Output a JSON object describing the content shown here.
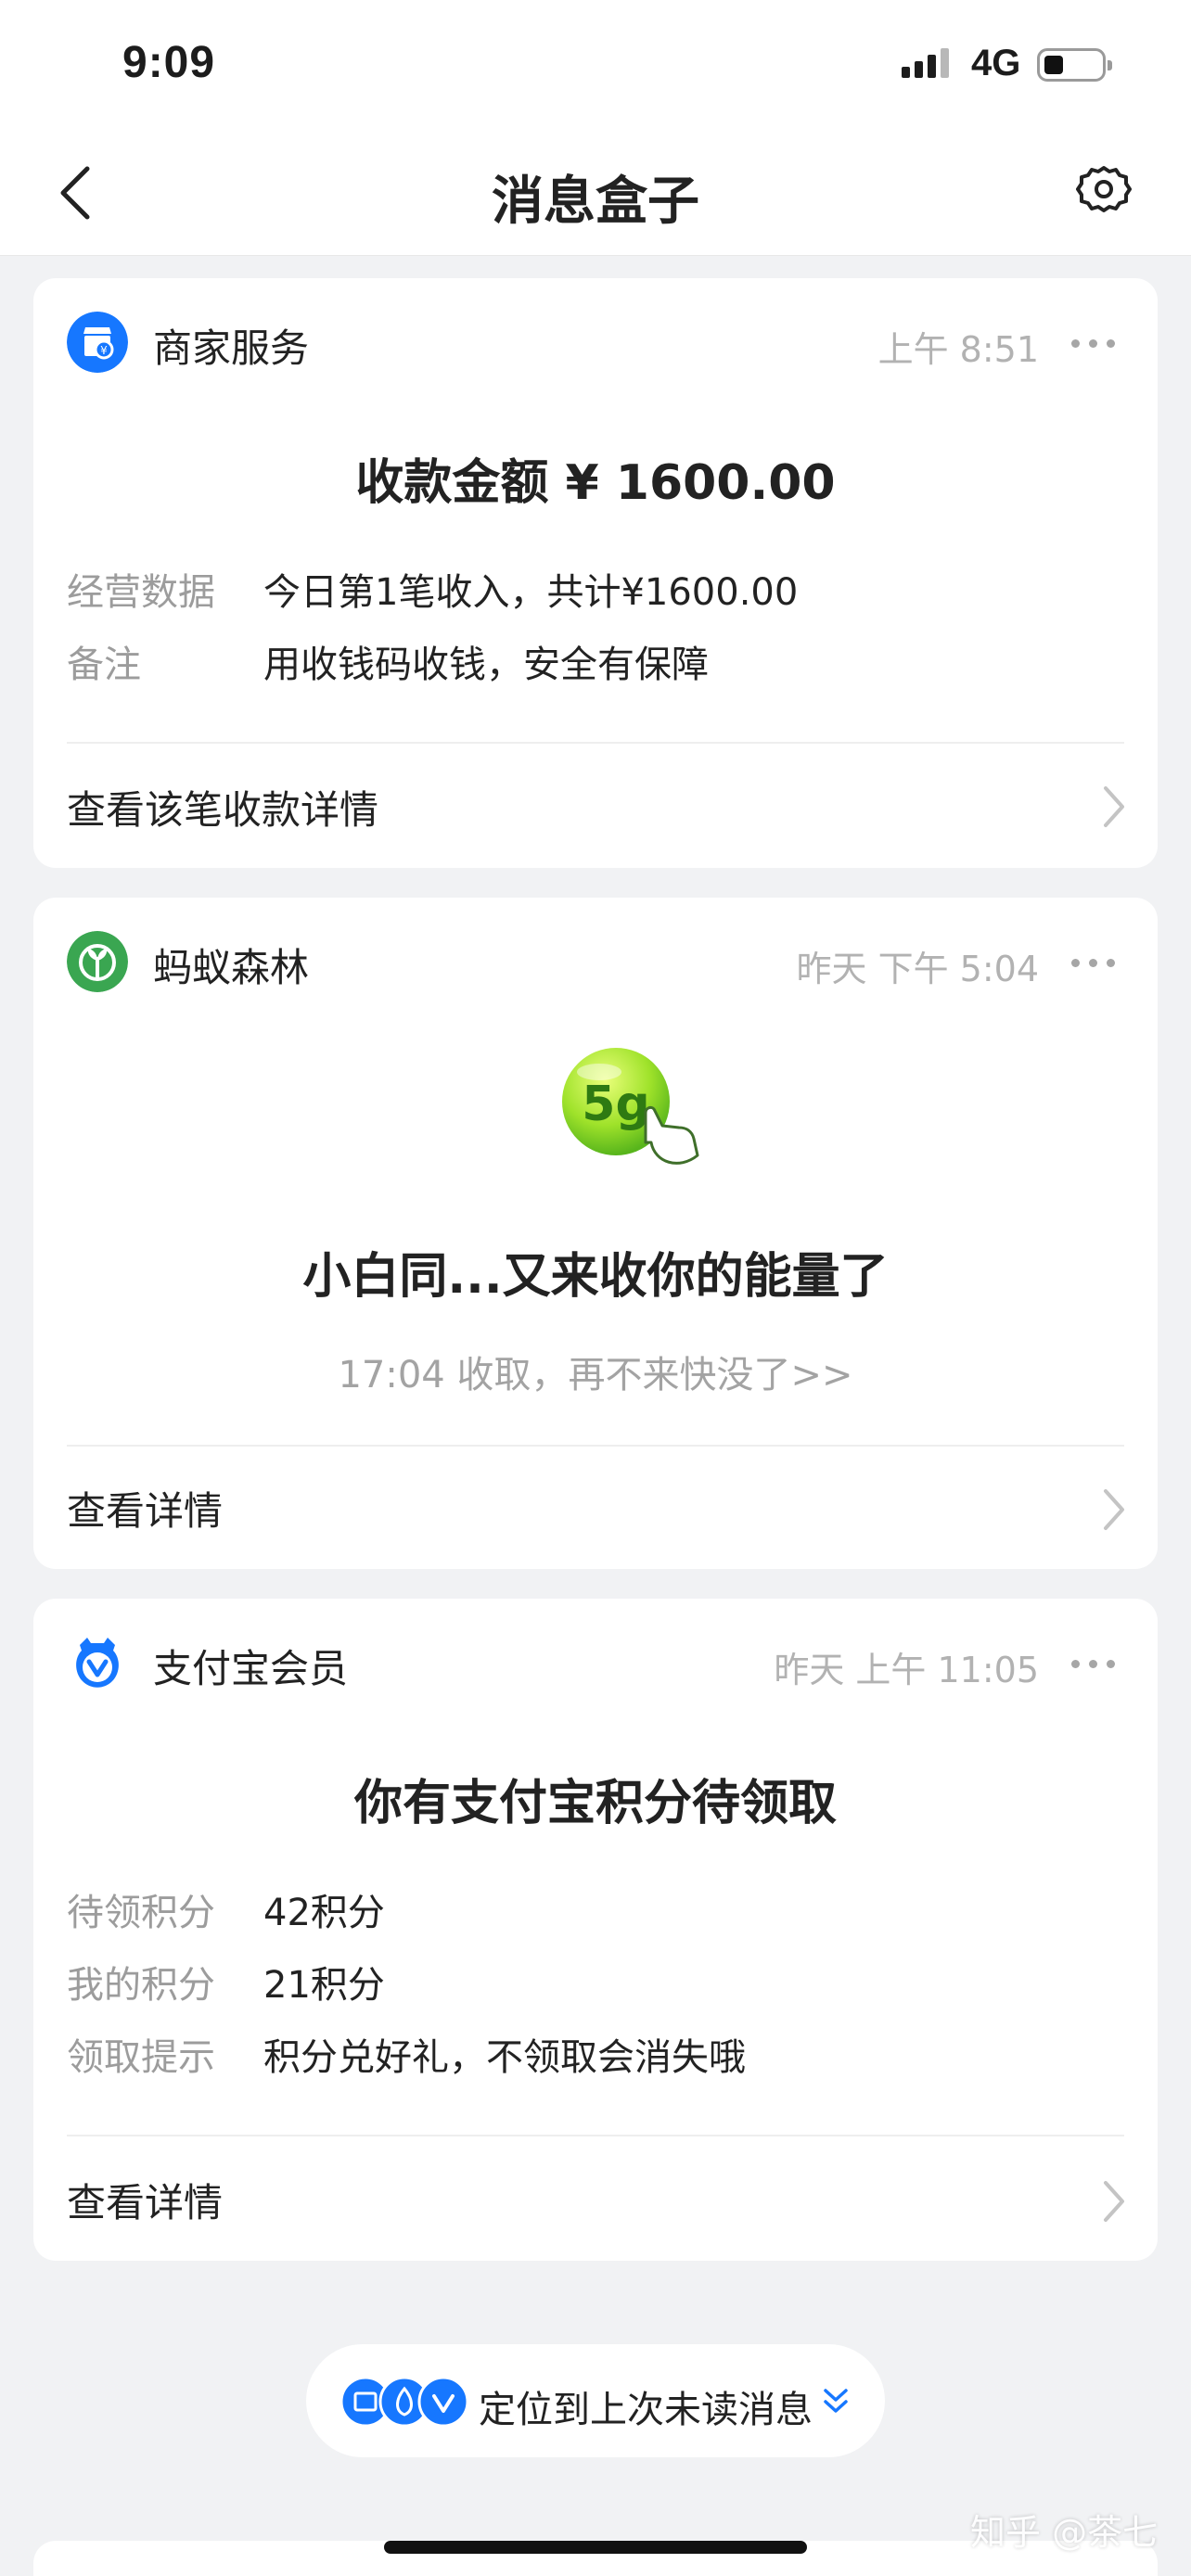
{
  "status_bar": {
    "time": "9:09",
    "network": "4G"
  },
  "nav": {
    "title": "消息盒子",
    "back_icon": "chevron-left-icon",
    "settings_icon": "gear-icon"
  },
  "cards": [
    {
      "app": "商家服务",
      "icon": "merchant-shop-icon",
      "icon_color": "#1677ff",
      "time": "上午 8:51",
      "title": "收款金额 ¥ 1600.00",
      "rows": [
        {
          "label": "经营数据",
          "value": "今日第1笔收入，共计¥1600.00"
        },
        {
          "label": "备注",
          "value": "用收钱码收钱，安全有保障"
        }
      ],
      "link": "查看该笔收款详情"
    },
    {
      "app": "蚂蚁森林",
      "icon": "ant-forest-sprout-icon",
      "icon_color": "#3aa651",
      "time": "昨天 下午 5:04",
      "energy_badge": "5g",
      "title": "小白同...又来收你的能量了",
      "subtitle": "17:04 收取，再不来快没了>>",
      "link": "查看详情"
    },
    {
      "app": "支付宝会员",
      "icon": "alipay-member-icon",
      "icon_color": "#1677ff",
      "time": "昨天 上午 11:05",
      "title": "你有支付宝积分待领取",
      "rows": [
        {
          "label": "待领积分",
          "value": "42积分"
        },
        {
          "label": "我的积分",
          "value": "21积分"
        },
        {
          "label": "领取提示",
          "value": "积分兑好礼，不领取会消失哦"
        }
      ],
      "link": "查看详情"
    }
  ],
  "jump_pill": {
    "label": "定位到上次未读消息",
    "icon": "double-chevron-down-icon"
  },
  "watermark": "知乎 @茶七"
}
